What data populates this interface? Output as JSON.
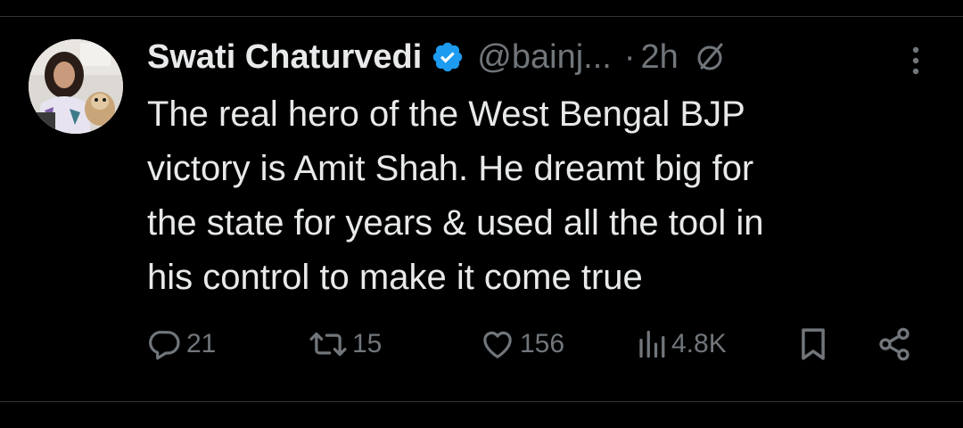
{
  "tweet": {
    "author_name": "Swati Chaturvedi",
    "handle": "@bainj...",
    "separator": "·",
    "time": "2h",
    "text": "The real hero of the West Bengal BJP\nvictory is Amit Shah. He dreamt big for\nthe state for years & used all the tool in\nhis control to make it come true"
  },
  "icons": {
    "verified": "verified-badge-icon",
    "grok": "grok-icon",
    "more": "more-options-icon",
    "reply": "reply-icon",
    "retweet": "retweet-icon",
    "like": "like-icon",
    "views": "views-icon",
    "bookmark": "bookmark-icon",
    "share": "share-icon"
  },
  "metrics": {
    "replies": "21",
    "retweets": "15",
    "likes": "156",
    "views": "4.8K"
  },
  "colors": {
    "background": "#000000",
    "text": "#e7e9ea",
    "muted": "#71767b",
    "verified": "#1d9bf0",
    "divider": "#2f3336"
  }
}
